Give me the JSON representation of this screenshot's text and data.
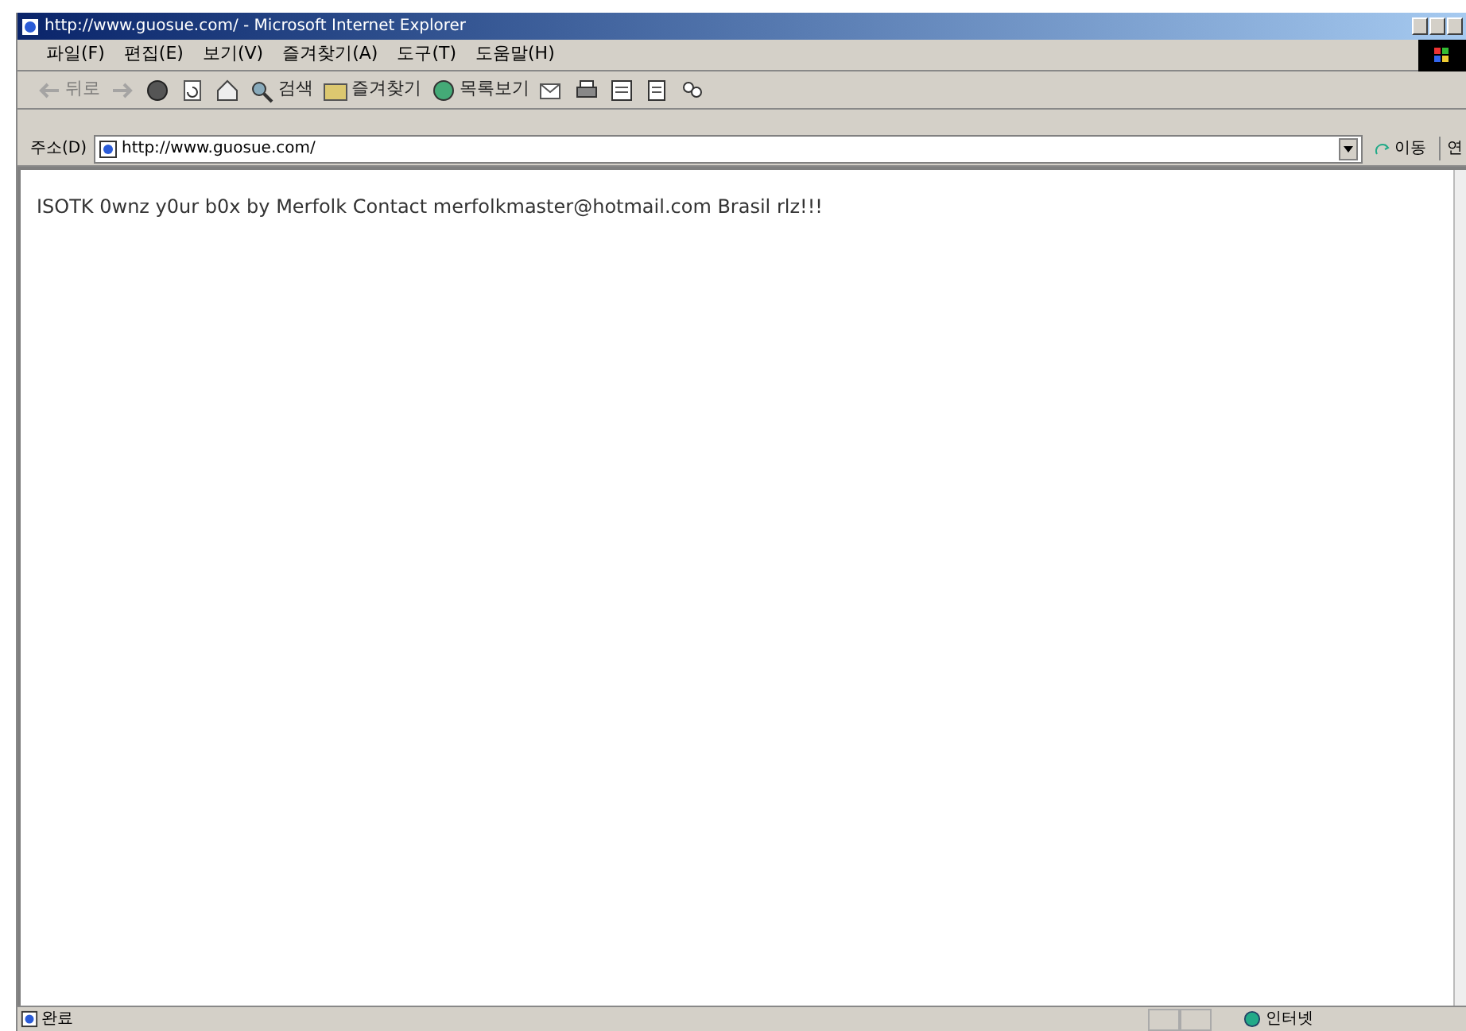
{
  "window": {
    "title": "http://www.guosue.com/ - Microsoft Internet Explorer"
  },
  "menu": [
    "파일(F)",
    "편집(E)",
    "보기(V)",
    "즐겨찾기(A)",
    "도구(T)",
    "도움말(H)"
  ],
  "toolbar": [
    {
      "kind": "labeled",
      "label": "뒤로",
      "disabled": true
    },
    {
      "kind": "icon",
      "disabled": true
    },
    {
      "kind": "icon",
      "disabled": false
    },
    {
      "kind": "icon",
      "disabled": false
    },
    {
      "kind": "icon",
      "disabled": false
    },
    {
      "kind": "labeled",
      "label": "검색",
      "disabled": false
    },
    {
      "kind": "labeled",
      "label": "즐겨찾기",
      "disabled": false
    },
    {
      "kind": "labeled",
      "label": "목록보기",
      "disabled": false
    },
    {
      "kind": "icon",
      "disabled": false
    },
    {
      "kind": "icon",
      "disabled": false
    },
    {
      "kind": "icon",
      "disabled": false
    },
    {
      "kind": "icon",
      "disabled": false
    },
    {
      "kind": "icon",
      "disabled": false
    }
  ],
  "address": {
    "label": "주소(D)",
    "url": "http://www.guosue.com/",
    "go": "이동",
    "links": "연"
  },
  "content": {
    "text": "ISOTK 0wnz y0ur b0x by Merfolk Contact merfolkmaster@hotmail.com Brasil rlz!!!"
  },
  "status_bar": {
    "text": "완료",
    "zone": "인터넷"
  }
}
